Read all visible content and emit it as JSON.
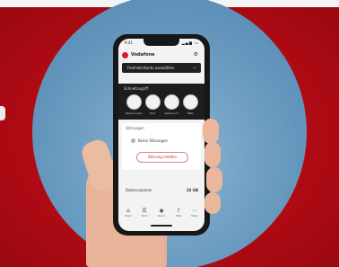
{
  "scene": {
    "colors": {
      "background_red": "#b00b14",
      "sky_blue": "#6d9dc2",
      "phone_body": "#171717",
      "skin": "#e9b59a"
    }
  },
  "phone": {
    "status": {
      "time": "9:41",
      "icons": "▂▄▆ ▭"
    },
    "app": {
      "name": "Vodafone",
      "menu_icon": "⚙",
      "account_select": {
        "value": "Festnetz-Konto auswählen",
        "chevron_icon": "chevron-down-icon"
      }
    },
    "banner": {
      "title": "Schnellzugriff",
      "actions": [
        {
          "label": "Rechnungen",
          "icon": "document-icon"
        },
        {
          "label": "Tarif",
          "icon": "tariff-icon"
        },
        {
          "label": "Verbrauch",
          "icon": "usage-icon"
        },
        {
          "label": "Hilfe",
          "icon": "help-icon"
        }
      ]
    },
    "section": {
      "title": "Störungen",
      "item_text": "Keine Störungen",
      "button_label": "Störung melden"
    },
    "summary": {
      "label": "Datenvolumen",
      "value": "10 GB"
    },
    "tabbar": [
      {
        "label": "Start",
        "icon": "⌂"
      },
      {
        "label": "Tarif",
        "icon": "☰"
      },
      {
        "label": "Konto",
        "icon": "◉"
      },
      {
        "label": "Hilfe",
        "icon": "?"
      },
      {
        "label": "Mehr",
        "icon": "⋯"
      }
    ]
  }
}
